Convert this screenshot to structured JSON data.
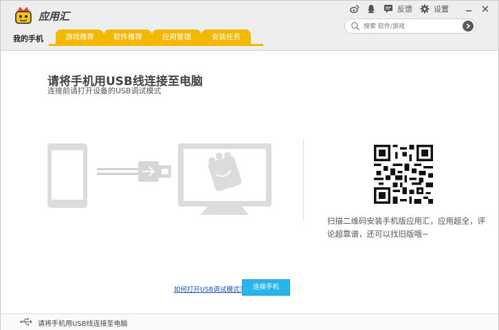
{
  "header": {
    "app_title": "应用汇",
    "home_tab": "我的手机",
    "tabs": [
      "游戏推荐",
      "软件推荐",
      "应用管理",
      "安装任务"
    ],
    "feedback_label": "反馈",
    "settings_label": "设置",
    "search_placeholder": "搜索 软件/游戏",
    "accent_color": "#f5b800"
  },
  "main": {
    "title": "请将手机用USB线连接至电脑",
    "subtitle": "连接前请打开设备的USB调试模式",
    "qr_text": "扫描二维码安装手机版应用汇，应用超全，评论超靠谱，还可以找旧版哦~",
    "help_link": "如何打开USB调试模式？",
    "connect_button": "连接手机",
    "button_color": "#28b4ec"
  },
  "footer": {
    "status_text": "请将手机用USB线连接至电脑"
  },
  "icons": [
    "app-logo-icon",
    "weibo-icon",
    "qq-icon",
    "feedback-icon",
    "gear-icon",
    "minimize-icon",
    "close-icon",
    "search-icon",
    "arrow-right-icon",
    "usb-icon",
    "qr-code"
  ]
}
